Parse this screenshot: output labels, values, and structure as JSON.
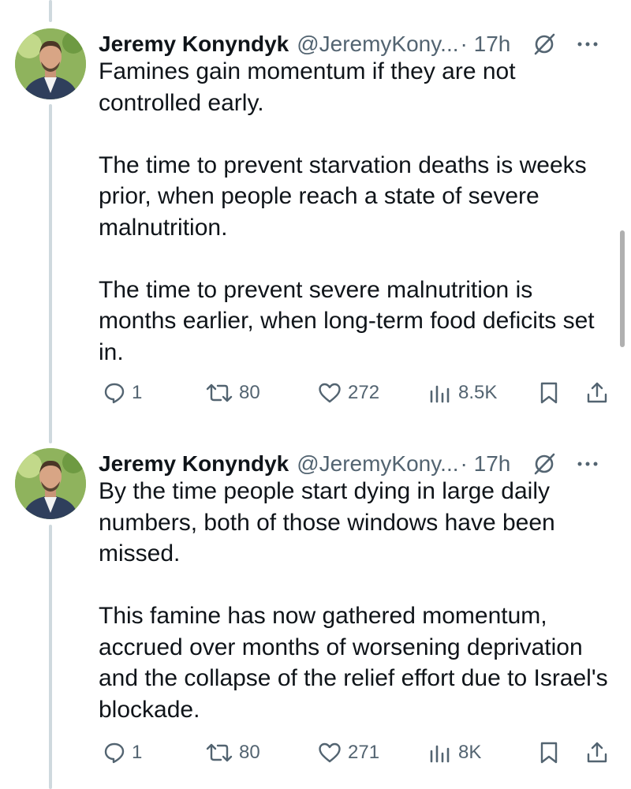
{
  "tweets": [
    {
      "name": "Jeremy Konyndyk",
      "handle": "@JeremyKony...",
      "time": "· 17h",
      "paragraphs": [
        "Famines gain momentum if they are not controlled early.",
        "The time to prevent starvation deaths is weeks prior, when people reach a state of severe malnutrition.",
        "The time to prevent severe malnutrition is months earlier, when long-term food deficits set in."
      ],
      "stats": {
        "replies": "1",
        "reposts": "80",
        "likes": "272",
        "views": "8.5K"
      }
    },
    {
      "name": "Jeremy Konyndyk",
      "handle": "@JeremyKony...",
      "time": "· 17h",
      "paragraphs": [
        "By the time people start dying in large daily numbers, both of those windows have been missed.",
        "This famine has now gathered momentum, accrued over months of worsening deprivation and the collapse of the relief effort due to Israel's blockade."
      ],
      "stats": {
        "replies": "1",
        "reposts": "80",
        "likes": "271",
        "views": "8K"
      }
    }
  ],
  "icons": {
    "reply": "reply-icon",
    "repost": "repost-icon",
    "like": "like-icon",
    "views": "views-icon",
    "bookmark": "bookmark-icon",
    "share": "share-icon",
    "grok": "grok-icon",
    "more": "more-icon"
  },
  "colors": {
    "text": "#0f1419",
    "secondary": "#536471",
    "thread_line": "#cfd9de"
  }
}
